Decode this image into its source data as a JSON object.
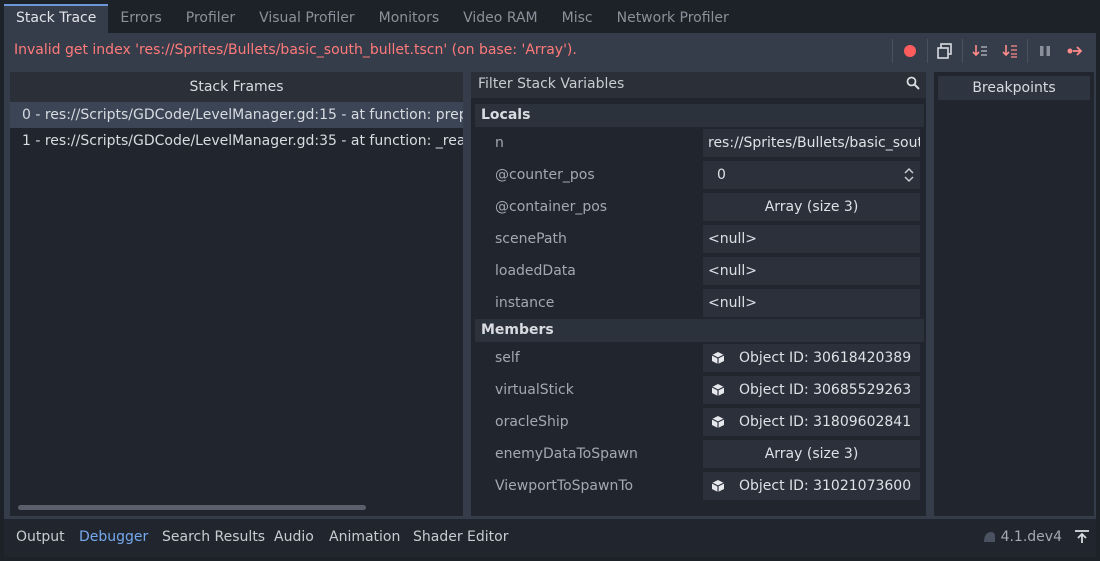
{
  "tabs": [
    "Stack Trace",
    "Errors",
    "Profiler",
    "Visual Profiler",
    "Monitors",
    "Video RAM",
    "Misc",
    "Network Profiler"
  ],
  "error": "Invalid get index 'res://Sprites/Bullets/basic_south_bullet.tscn' (on base: 'Array').",
  "toolbar_icons": [
    "record-dot-icon",
    "copy-icon",
    "step-into-icon",
    "step-over-icon",
    "pause-icon",
    "continue-icon"
  ],
  "colors": {
    "accent": "#75a8ee",
    "error": "#ff7a7a",
    "record": "#ff5d5d"
  },
  "frames": {
    "header": "Stack Frames",
    "items": [
      "0 - res://Scripts/GDCode/LevelManager.gd:15 - at function: prepareSpawns",
      "1 - res://Scripts/GDCode/LevelManager.gd:35 - at function: _ready"
    ]
  },
  "vars": {
    "filter_placeholder": "Filter Stack Variables",
    "locals_label": "Locals",
    "members_label": "Members",
    "locals": [
      {
        "name": "n",
        "value": "res://Sprites/Bullets/basic_south_bullet.tscn"
      },
      {
        "name": "@counter_pos",
        "value": "0"
      },
      {
        "name": "@container_pos",
        "value": "Array (size 3)"
      },
      {
        "name": "scenePath",
        "value": "<null>"
      },
      {
        "name": "loadedData",
        "value": "<null>"
      },
      {
        "name": "instance",
        "value": "<null>"
      }
    ],
    "members": [
      {
        "name": "self",
        "value": "Object ID: 30618420389"
      },
      {
        "name": "virtualStick",
        "value": "Object ID: 30685529263"
      },
      {
        "name": "oracleShip",
        "value": "Object ID: 31809602841"
      },
      {
        "name": "enemyDataToSpawn",
        "value": "Array (size 3)"
      },
      {
        "name": "ViewportToSpawnTo",
        "value": "Object ID: 31021073600"
      }
    ]
  },
  "breakpoints": {
    "header": "Breakpoints"
  },
  "bottom_tabs": [
    "Output",
    "Debugger",
    "Search Results",
    "Audio",
    "Animation",
    "Shader Editor"
  ],
  "version": "4.1.dev4"
}
